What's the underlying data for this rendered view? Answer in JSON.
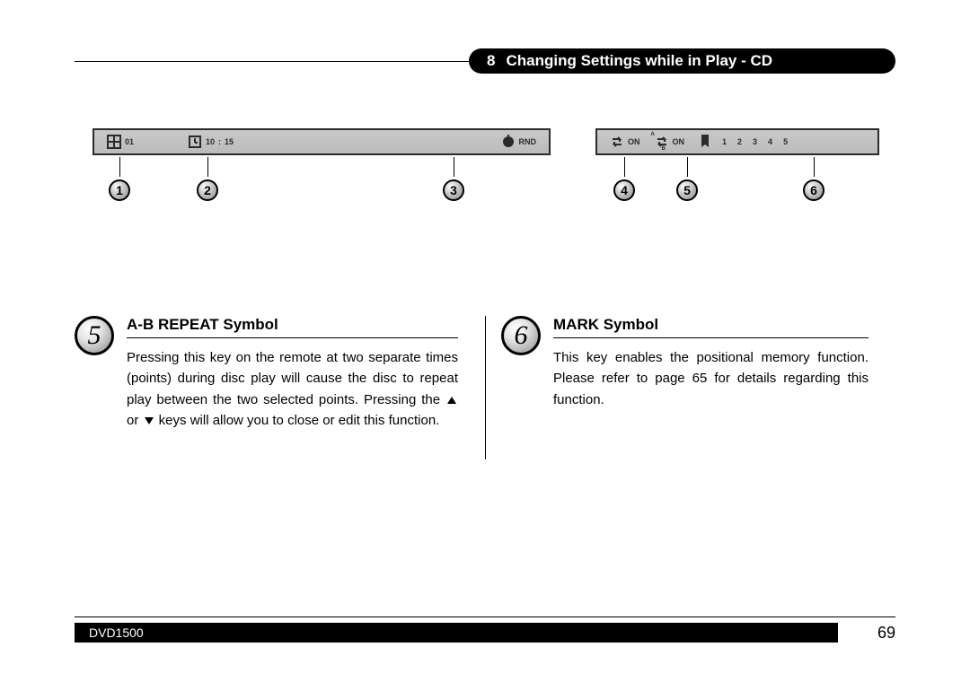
{
  "header": {
    "section_number": "8",
    "section_title": "Changing Settings while in Play - CD"
  },
  "osd_left": {
    "track": "01",
    "time_min": "10",
    "time_sep": ":",
    "time_sec": "15",
    "mode": "RND"
  },
  "osd_right": {
    "repeat_label": "ON",
    "ab_a": "A",
    "ab_b": "B",
    "ab_label": "ON",
    "marks": [
      "1",
      "2",
      "3",
      "4",
      "5"
    ]
  },
  "callouts": {
    "c1": "1",
    "c2": "2",
    "c3": "3",
    "c4": "4",
    "c5": "5",
    "c6": "6"
  },
  "sections": {
    "s5": {
      "num": "5",
      "title": "A-B REPEAT Symbol",
      "text_before": "Pressing this key on the remote at two separate times (points) during disc play will cause the disc to repeat play between the two selected points. Pressing the ",
      "text_mid": " or ",
      "text_after": " keys will allow you to close or edit this function."
    },
    "s6": {
      "num": "6",
      "title": "MARK Symbol",
      "text": "This key enables the positional memory function. Please refer to page 65 for details regarding this function."
    }
  },
  "footer": {
    "model": "DVD1500",
    "page": "69"
  }
}
